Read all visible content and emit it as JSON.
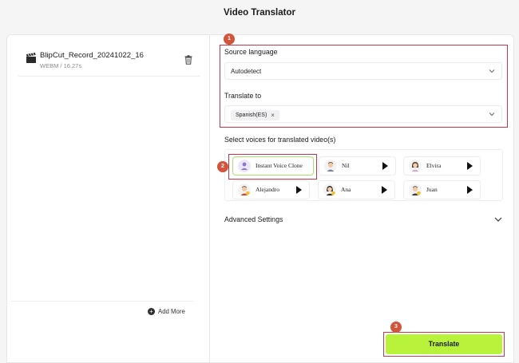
{
  "app": {
    "title": "Video Translator"
  },
  "file": {
    "name": "BlipCut_Record_20241022_16",
    "meta": "WEBM / 16.27s"
  },
  "left_footer": {
    "add_more": "Add More"
  },
  "source": {
    "label": "Source language",
    "value": "Autodetect"
  },
  "target": {
    "label": "Translate to",
    "chips": [
      "Spanish(ES)"
    ]
  },
  "voices": {
    "label": "Select voices for translated video(s)",
    "items": [
      {
        "name": "Instant Voice Clone",
        "selected": true
      },
      {
        "name": "Nil",
        "selected": false
      },
      {
        "name": "Elvira",
        "selected": false
      },
      {
        "name": "Alejandro",
        "selected": false
      },
      {
        "name": "Ana",
        "selected": false
      },
      {
        "name": "Juan",
        "selected": false
      }
    ]
  },
  "advanced": {
    "label": "Advanced Settings"
  },
  "actions": {
    "translate": "Translate"
  },
  "annotations": {
    "badge1": "1",
    "badge2": "2",
    "badge3": "3"
  },
  "colors": {
    "accent": "#b8f23b",
    "highlight": "#c6364a",
    "badge": "#d2543b"
  }
}
